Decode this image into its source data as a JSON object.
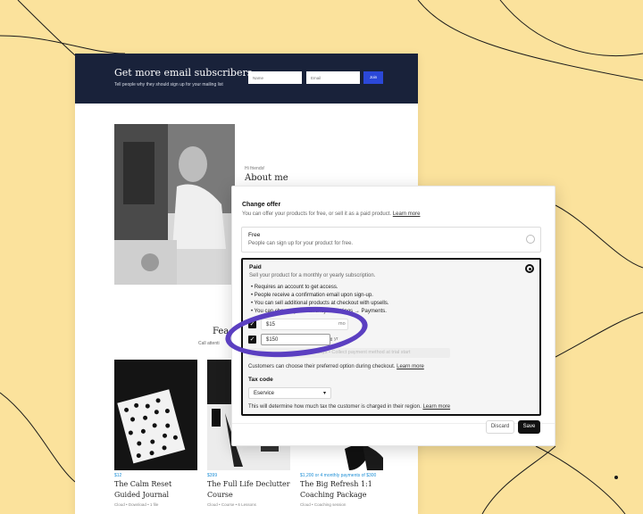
{
  "banner": {
    "title": "Get more email subscribers",
    "subtitle": "Tell people why they should sign up for your mailing list",
    "name_placeholder": "Name",
    "email_placeholder": "Email",
    "join_label": "Join"
  },
  "about": {
    "greeting": "Hi friends!",
    "title": "About me"
  },
  "featured": {
    "title": "Fea",
    "subtitle": "Call attenti"
  },
  "products": [
    {
      "price": "$12",
      "title": "The Calm Reset Guided Journal",
      "meta": "Cloud • Download • 1 file"
    },
    {
      "price": "$399",
      "title": "The Full Life Declutter Course",
      "meta": "Cloud • Course • 6 Lessons"
    },
    {
      "price": "$1,200 or 4 monthly payments of $300",
      "title": "The Big Refresh 1:1 Coaching Package",
      "meta": "Cloud • Coaching session"
    }
  ],
  "modal": {
    "title": "Change offer",
    "subtitle": "You can offer your products for free, or sell it as a paid product.",
    "learn_more": "Learn more",
    "free": {
      "label": "Free",
      "description": "People can sign up for your product for free."
    },
    "paid": {
      "label": "Paid",
      "description": "Sell your product for a monthly or yearly subscription.",
      "bullets": [
        "Requires an account to get access.",
        "People receive a confirmation email upon sign-up.",
        "You can sell additional products at checkout with upsells.",
        "You can change your currency in Settings → Payments."
      ],
      "monthly_value": "$15",
      "monthly_unit": "mo",
      "yearly_value": "$150",
      "yearly_unit": "yr",
      "trial_text": "Free days • Collect payment method at trial start",
      "choose_text": "Customers can choose their preferred option during checkout.",
      "tax_label": "Tax code",
      "tax_value": "Eservice",
      "tax_help": "This will determine how much tax the customer is charged in their region."
    },
    "discard_label": "Discard",
    "save_label": "Save"
  },
  "colors": {
    "background": "#fbe29c",
    "banner": "#19223a",
    "join_button": "#2b48d8",
    "highlight_ring": "#5b3fc1",
    "price_text": "#1e8fd6"
  }
}
